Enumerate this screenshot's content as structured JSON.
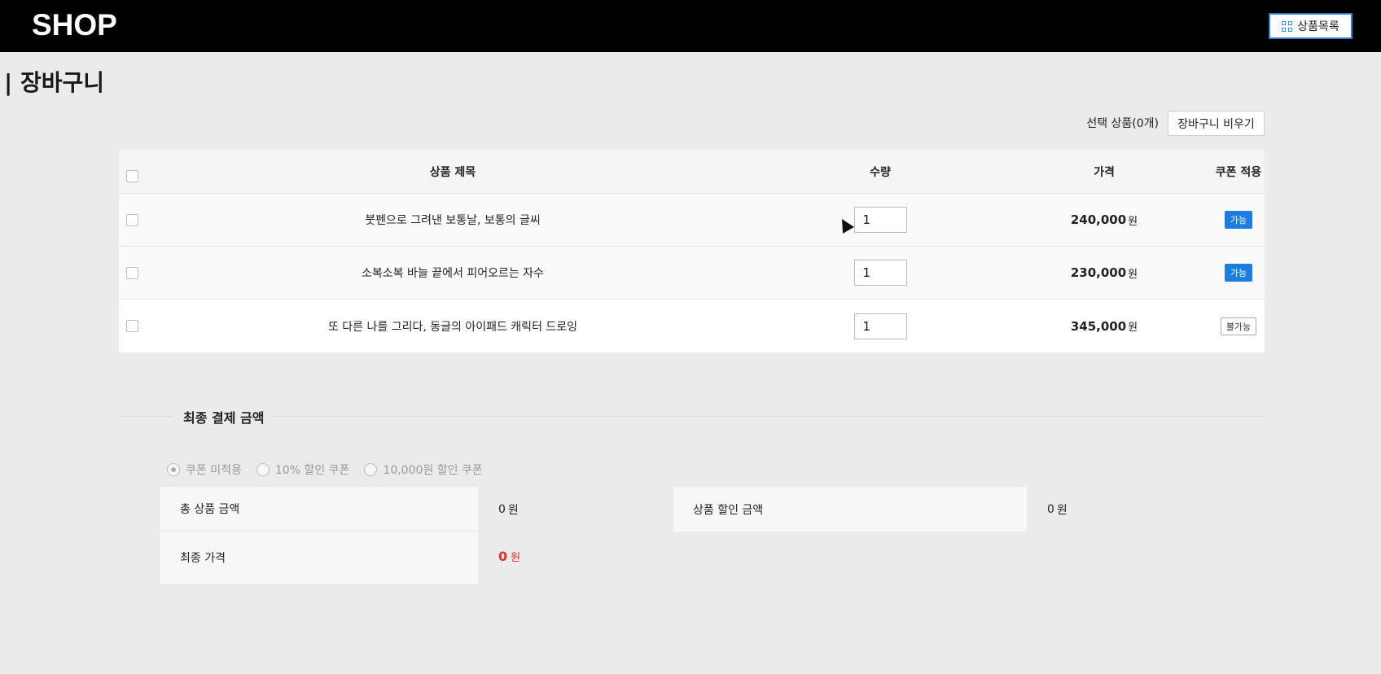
{
  "header": {
    "logo": "SHOP",
    "nav_button": "상품목록",
    "nav_icon": "grid-icon",
    "accent": "#2f7fd0"
  },
  "page": {
    "title": "| 장바구니"
  },
  "toolbar": {
    "selected_label": "선택 상품(0개)",
    "clear_label": "장바구니 비우기"
  },
  "table": {
    "headers": [
      "상품 제목",
      "수량",
      "가격",
      "쿠폰 적용"
    ],
    "rows": [
      {
        "title": "붓펜으로 그려낸 보통날, 보통의 글씨",
        "qty": "1",
        "price": "240,000",
        "unit": "원",
        "coupon": "가능",
        "coupon_ok": true
      },
      {
        "title": "소복소복 바늘 끝에서 피어오르는 자수",
        "qty": "1",
        "price": "230,000",
        "unit": "원",
        "coupon": "가능",
        "coupon_ok": true
      },
      {
        "title": "또 다른 나를 그리다, 동글의 아이패드 캐릭터 드로잉",
        "qty": "1",
        "price": "345,000",
        "unit": "원",
        "coupon": "불가능",
        "coupon_ok": false
      }
    ]
  },
  "summary": {
    "title": "최종 결제 금액",
    "coupons": [
      {
        "label": "쿠폰 미적용",
        "selected": true
      },
      {
        "label": "10% 할인 쿠폰",
        "selected": false
      },
      {
        "label": "10,000원 할인 쿠폰",
        "selected": false
      }
    ],
    "total_label": "총 상품 금액",
    "total_value": "0",
    "discount_label": "상품 할인 금액",
    "discount_value": "0",
    "final_label": "최종 가격",
    "final_value": "0",
    "unit": "원",
    "final_color": "#e4302b"
  }
}
